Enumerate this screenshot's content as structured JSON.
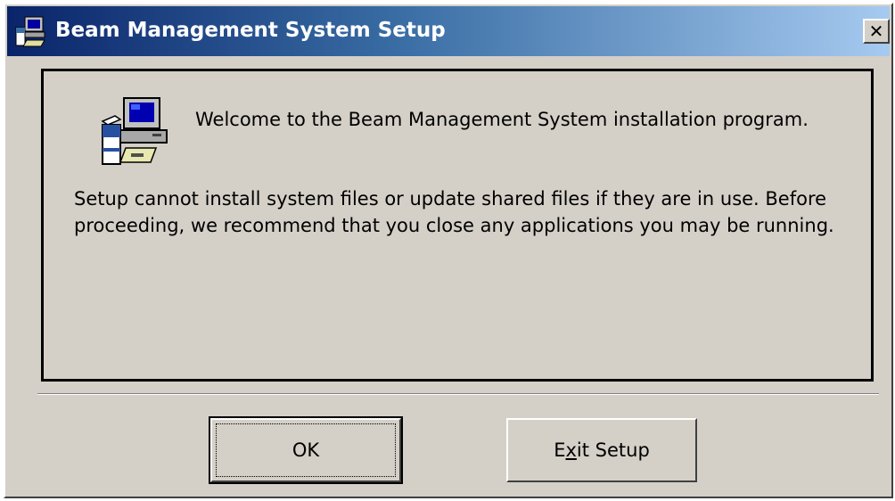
{
  "window": {
    "title": "Beam Management System Setup",
    "close_glyph": "✕",
    "icon": "setup-app-icon"
  },
  "content": {
    "icon": "computer-setup-icon",
    "welcome": "Welcome to the Beam Management System installation program.",
    "message": "Setup cannot install system files or update shared files if they are in use. Before proceeding, we recommend that you close any applications you may be running."
  },
  "buttons": {
    "ok_label": "OK",
    "exit_pre": "E",
    "exit_mnemonic": "x",
    "exit_post": "it Setup"
  },
  "colors": {
    "titlebar_start": "#0a246a",
    "titlebar_end": "#a6caf0",
    "window_bg": "#d4d0c8"
  }
}
